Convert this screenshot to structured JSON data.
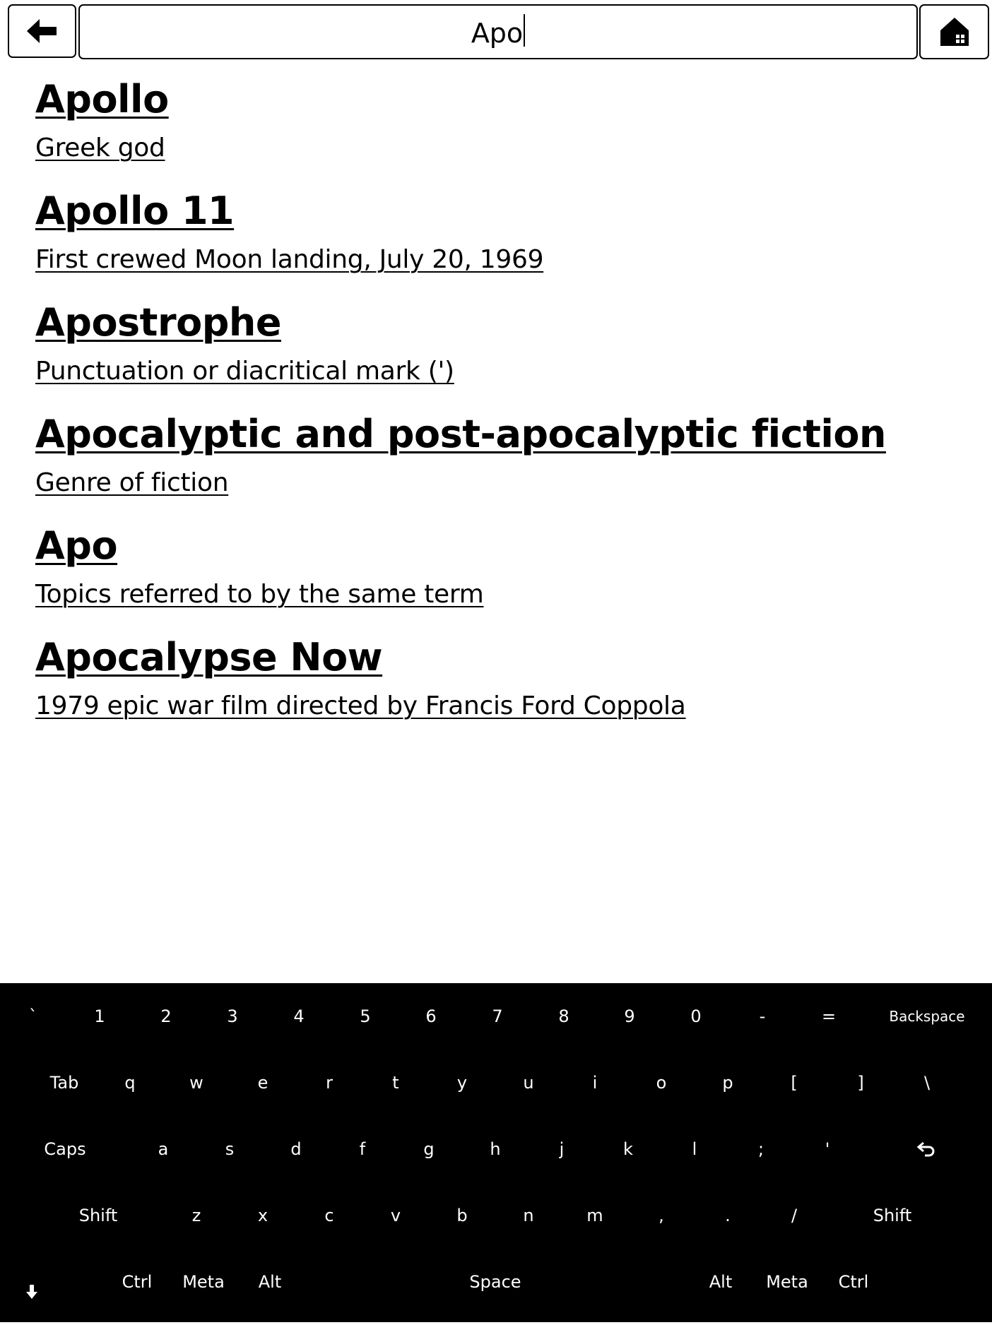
{
  "topbar": {
    "back_icon": "arrow-left-icon",
    "search_value": "Apo",
    "home_icon": "home-icon"
  },
  "results": [
    {
      "title": "Apollo",
      "description": "Greek god"
    },
    {
      "title": "Apollo 11",
      "description": "First crewed Moon landing, July 20, 1969"
    },
    {
      "title": "Apostrophe",
      "description": "Punctuation or diacritical mark (')"
    },
    {
      "title": "Apocalyptic and post-apocalyptic fiction",
      "description": "Genre of fiction"
    },
    {
      "title": "Apo",
      "description": "Topics referred to by the same term"
    },
    {
      "title": "Apocalypse Now",
      "description": "1979 epic war film directed by Francis Ford Coppola"
    }
  ],
  "keyboard": {
    "row1": [
      "`",
      "1",
      "2",
      "3",
      "4",
      "5",
      "6",
      "7",
      "8",
      "9",
      "0",
      "-",
      "=",
      "Backspace"
    ],
    "row2": [
      "Tab",
      "q",
      "w",
      "e",
      "r",
      "t",
      "y",
      "u",
      "i",
      "o",
      "p",
      "[",
      "]",
      "\\"
    ],
    "row3": [
      "Caps",
      "a",
      "s",
      "d",
      "f",
      "g",
      "h",
      "j",
      "k",
      "l",
      ";",
      "'",
      "⮐"
    ],
    "row4": [
      "Shift",
      "z",
      "x",
      "c",
      "v",
      "b",
      "n",
      "m",
      ",",
      ".",
      "/",
      "Shift"
    ],
    "row5": [
      "🡇",
      "Ctrl",
      "Meta",
      "Alt",
      "Space",
      "Alt",
      "Meta",
      "Ctrl"
    ],
    "enter_icon": "enter-icon",
    "hide_icon": "hide-keyboard-icon"
  }
}
